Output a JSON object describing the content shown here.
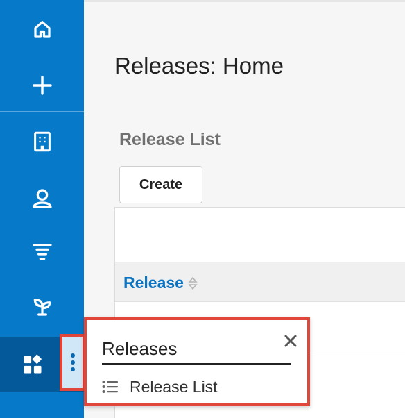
{
  "sidebar": {
    "items": [
      {
        "icon": "home-icon"
      },
      {
        "icon": "plus-icon"
      },
      {
        "icon": "building-icon"
      },
      {
        "icon": "user-icon"
      },
      {
        "icon": "filter-icon"
      },
      {
        "icon": "sprout-icon"
      },
      {
        "icon": "apps-icon"
      }
    ]
  },
  "page": {
    "title": "Releases: Home",
    "section_title": "Release List",
    "create_label": "Create"
  },
  "table": {
    "columns": [
      "Release"
    ]
  },
  "popup": {
    "title": "Releases",
    "items": [
      {
        "label": "Release List",
        "icon": "list-icon"
      }
    ]
  },
  "colors": {
    "sidebar": "#0679c8",
    "sidebar_active": "#04599b",
    "link": "#0b74c4",
    "highlight": "#e0473a"
  }
}
